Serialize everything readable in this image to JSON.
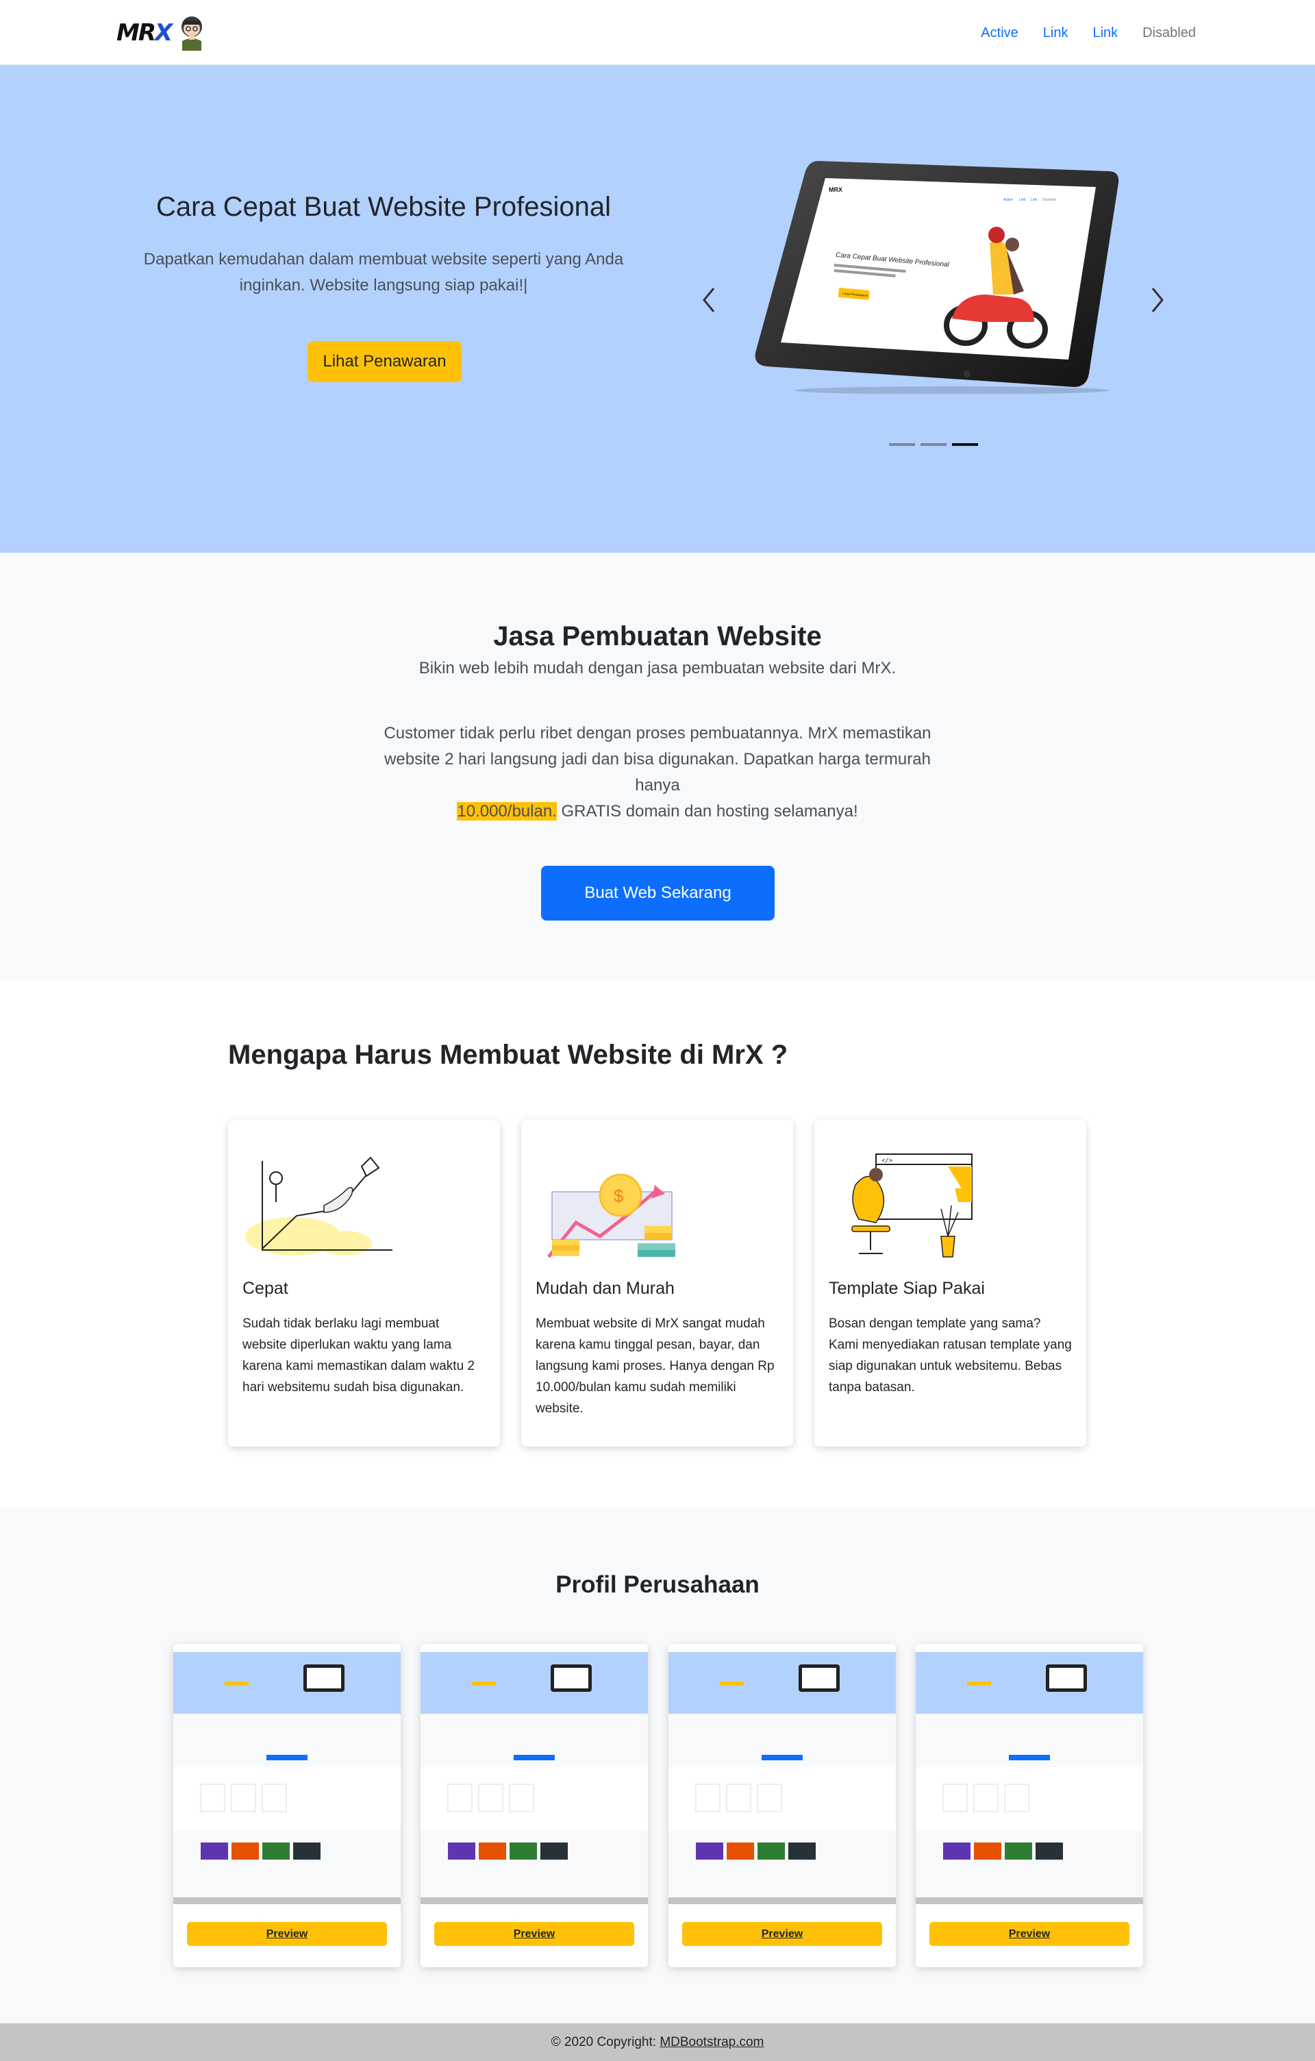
{
  "navbar": {
    "brand_text": "MRX",
    "links": [
      "Active",
      "Link",
      "Link",
      "Disabled"
    ]
  },
  "hero": {
    "title": "Cara Cepat Buat Website Profesional",
    "subtitle": "Dapatkan kemudahan dalam membuat website seperti yang Anda inginkan. Website langsung siap pakai!|",
    "cta": "Lihat Penawaran",
    "carousel_count": 3,
    "carousel_active": 3,
    "tablet_screen": {
      "title": "Cara Cepat Buat Website Profesional",
      "nav": [
        "Active",
        "Link",
        "Link",
        "Disabled"
      ],
      "cta": "Lihat Penawaran"
    }
  },
  "jasa": {
    "title": "Jasa Pembuatan Website",
    "subtitle": "Bikin web lebih mudah dengan jasa pembuatan website dari MrX.",
    "body_1": "Customer tidak perlu ribet dengan proses pembuatannya. MrX memastikan website 2 hari langsung jadi dan bisa digunakan. Dapatkan harga termurah hanya",
    "highlight": "10.000/bulan.",
    "body_2": " GRATIS domain dan hosting selamanya!",
    "cta": "Buat Web Sekarang"
  },
  "why": {
    "title": "Mengapa Harus Membuat Website di MrX ?",
    "cards": [
      {
        "title": "Cepat",
        "text": "Sudah tidak berlaku lagi membuat website diperlukan waktu yang lama karena kami memastikan dalam waktu 2 hari websitemu sudah bisa digunakan."
      },
      {
        "title": "Mudah dan Murah",
        "text": "Membuat website di MrX sangat mudah karena kamu tinggal pesan, bayar, dan langsung kami proses. Hanya dengan Rp 10.000/bulan kamu sudah memiliki website."
      },
      {
        "title": "Template Siap Pakai",
        "text": "Bosan dengan template yang sama? Kami menyediakan ratusan template yang siap digunakan untuk websitemu. Bebas tanpa batasan."
      }
    ]
  },
  "profil": {
    "title": "Profil Perusahaan",
    "cards": [
      {
        "button": "Preview"
      },
      {
        "button": "Preview"
      },
      {
        "button": "Preview"
      },
      {
        "button": "Preview"
      }
    ]
  },
  "footer": {
    "text": "© 2020 Copyright: ",
    "link": "MDBootstrap.com"
  },
  "colors": {
    "hero_bg": "#b3d1fd",
    "accent_yellow": "#ffc107",
    "primary_blue": "#0d6efd",
    "section_gray": "#f8f9fa",
    "footer_bg": "#c4c4c4"
  }
}
